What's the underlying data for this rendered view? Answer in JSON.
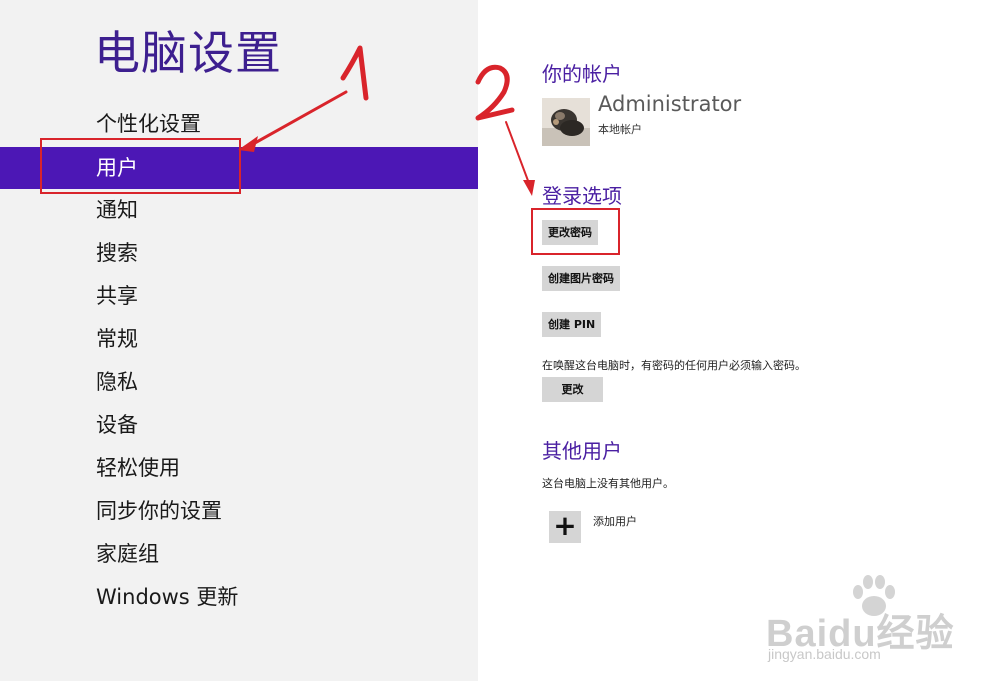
{
  "left": {
    "title": "电脑设置",
    "nav": [
      {
        "label": "个性化设置"
      },
      {
        "label": "用户"
      },
      {
        "label": "通知"
      },
      {
        "label": "搜索"
      },
      {
        "label": "共享"
      },
      {
        "label": "常规"
      },
      {
        "label": "隐私"
      },
      {
        "label": "设备"
      },
      {
        "label": "轻松使用"
      },
      {
        "label": "同步你的设置"
      },
      {
        "label": "家庭组"
      },
      {
        "label": "Windows 更新"
      }
    ],
    "selected_index": 1
  },
  "account": {
    "section_title": "你的帐户",
    "username": "Administrator",
    "account_type": "本地帐户"
  },
  "signin": {
    "section_title": "登录选项",
    "change_password": "更改密码",
    "create_picture_password": "创建图片密码",
    "create_pin": "创建 PIN",
    "wake_description": "在唤醒这台电脑时，有密码的任何用户必须输入密码。",
    "change_button": "更改"
  },
  "other_users": {
    "section_title": "其他用户",
    "description": "这台电脑上没有其他用户。",
    "add_user": "添加用户",
    "add_icon": "plus-icon"
  },
  "annotations": {
    "step_1": "1",
    "step_2": "2",
    "color": "#d9242b"
  },
  "watermark": {
    "brand": "Baidu经验",
    "url": "jingyan.baidu.com"
  },
  "colors": {
    "accent": "#4c17b5",
    "title": "#3d1f8f",
    "left_bg": "#f2f2f2"
  }
}
